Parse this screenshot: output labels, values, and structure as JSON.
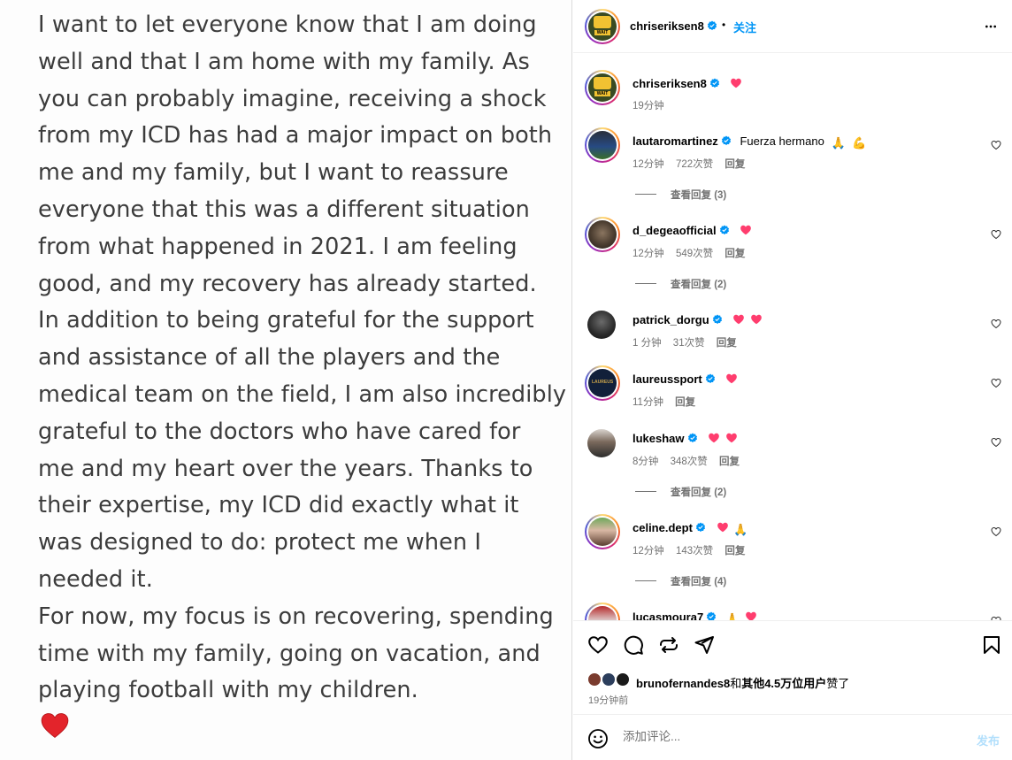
{
  "image_text": {
    "lines": [
      "I want to let everyone know that I am doing",
      "well and that I am home with my family. As",
      "you can probably imagine, receiving a shock",
      "from my ICD has had a major impact on both",
      "me and my family, but I want to reassure",
      "everyone that this was a different situation",
      "from what happened in 2021. I am feeling",
      "good, and my recovery has already started.",
      "In addition to being grateful for the support",
      "and assistance of all the players and the",
      "medical team on the field, I am also incredibly",
      "grateful to the doctors who have cared for",
      "me and my heart over the years. Thanks to",
      "their expertise, my ICD did exactly what it",
      "was designed to do: protect me when I",
      "needed it.",
      "For now, my focus is on recovering, spending",
      "time with my family, going on vacation, and",
      "playing football with my children."
    ],
    "end_emoji": "red-heart-icon"
  },
  "header": {
    "username": "chriseriksen8",
    "separator": "•",
    "follow_label": "关注",
    "more_icon": "more-horizontal-icon"
  },
  "caption": {
    "username": "chriseriksen8",
    "time": "19分钟"
  },
  "comments": [
    {
      "username": "lautaromartinez",
      "text": "Fuerza hermano",
      "emojis": [
        "pray",
        "muscle"
      ],
      "time": "12分钟",
      "likes": "722次赞",
      "reply": "回复",
      "view_replies": "查看回复 (3)"
    },
    {
      "username": "d_degeaofficial",
      "text": "",
      "emojis": [
        "heart"
      ],
      "time": "12分钟",
      "likes": "549次赞",
      "reply": "回复",
      "view_replies": "查看回复 (2)"
    },
    {
      "username": "patrick_dorgu",
      "text": "",
      "emojis": [
        "heart",
        "heart"
      ],
      "time": "1 分钟",
      "likes": "31次赞",
      "reply": "回复",
      "view_replies": ""
    },
    {
      "username": "laureussport",
      "text": "",
      "emojis": [
        "heart"
      ],
      "time": "11分钟",
      "likes": "",
      "reply": "回复",
      "view_replies": ""
    },
    {
      "username": "lukeshaw",
      "text": "",
      "emojis": [
        "heart",
        "heart"
      ],
      "time": "8分钟",
      "likes": "348次赞",
      "reply": "回复",
      "view_replies": "查看回复 (2)"
    },
    {
      "username": "celine.dept",
      "text": "",
      "emojis": [
        "heart",
        "pray"
      ],
      "time": "12分钟",
      "likes": "143次赞",
      "reply": "回复",
      "view_replies": "查看回复 (4)"
    },
    {
      "username": "lucasmoura7",
      "text": "",
      "emojis": [
        "pray",
        "heart"
      ],
      "time": "",
      "likes": "",
      "reply": "",
      "view_replies": ""
    }
  ],
  "actions": {
    "liked_by_user": "brunofernandes8",
    "liked_by_and": "和",
    "liked_by_others": "其他4.5万位用户",
    "liked_by_suffix": "赞了",
    "time_ago": "19分钟前"
  },
  "comment_box": {
    "placeholder": "添加评论...",
    "post_label": "发布"
  },
  "colors": {
    "accent": "#0095f6",
    "verified": "#0095f6",
    "heart": "#ff3040",
    "muted": "#737373"
  }
}
